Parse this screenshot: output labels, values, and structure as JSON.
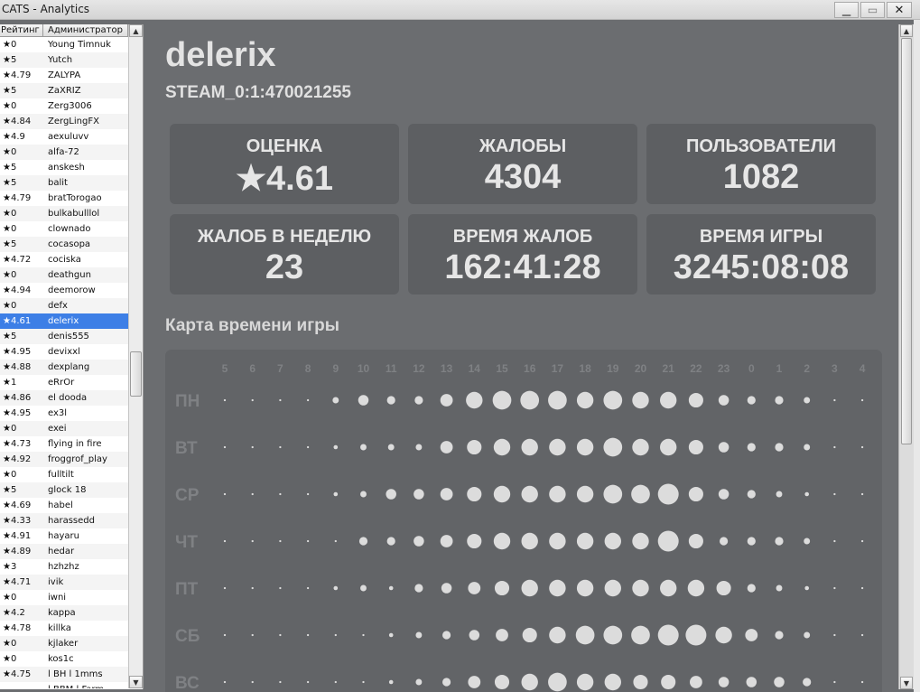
{
  "window": {
    "title": "CATS - Analytics"
  },
  "list": {
    "columns": [
      "Рейтинг",
      "Администратор"
    ],
    "rows": [
      {
        "rating": "★0",
        "name": "Young Timnuk"
      },
      {
        "rating": "★5",
        "name": "Yutch"
      },
      {
        "rating": "★4.79",
        "name": "ZALYPA"
      },
      {
        "rating": "★5",
        "name": "ZaXRIZ"
      },
      {
        "rating": "★0",
        "name": "Zerg3006"
      },
      {
        "rating": "★4.84",
        "name": "ZergLingFX"
      },
      {
        "rating": "★4.9",
        "name": "aexuluvv"
      },
      {
        "rating": "★0",
        "name": "alfa-72"
      },
      {
        "rating": "★5",
        "name": "anskesh"
      },
      {
        "rating": "★5",
        "name": "balit"
      },
      {
        "rating": "★4.79",
        "name": "bratTorogao"
      },
      {
        "rating": "★0",
        "name": "bulkabulllol"
      },
      {
        "rating": "★0",
        "name": "clownado"
      },
      {
        "rating": "★5",
        "name": "cocasopa"
      },
      {
        "rating": "★4.72",
        "name": "cociska"
      },
      {
        "rating": "★0",
        "name": "deathgun"
      },
      {
        "rating": "★4.94",
        "name": "deemorow"
      },
      {
        "rating": "★0",
        "name": "defx"
      },
      {
        "rating": "★4.61",
        "name": "delerix",
        "selected": true
      },
      {
        "rating": "★5",
        "name": "denis555"
      },
      {
        "rating": "★4.95",
        "name": "devixxl"
      },
      {
        "rating": "★4.88",
        "name": "dexplang"
      },
      {
        "rating": "★1",
        "name": "eRrOr"
      },
      {
        "rating": "★4.86",
        "name": "el dooda"
      },
      {
        "rating": "★4.95",
        "name": "ex3l"
      },
      {
        "rating": "★0",
        "name": "exei"
      },
      {
        "rating": "★4.73",
        "name": "flying in fire"
      },
      {
        "rating": "★4.92",
        "name": "froggrof_play"
      },
      {
        "rating": "★0",
        "name": "fulltilt"
      },
      {
        "rating": "★5",
        "name": "glock 18"
      },
      {
        "rating": "★4.69",
        "name": "habel"
      },
      {
        "rating": "★4.33",
        "name": "harassedd"
      },
      {
        "rating": "★4.91",
        "name": "hayaru"
      },
      {
        "rating": "★4.89",
        "name": "hedar"
      },
      {
        "rating": "★3",
        "name": "hzhzhz"
      },
      {
        "rating": "★4.71",
        "name": "ivik"
      },
      {
        "rating": "★0",
        "name": "iwni"
      },
      {
        "rating": "★4.2",
        "name": "kappa"
      },
      {
        "rating": "★4.78",
        "name": "killka"
      },
      {
        "rating": "★0",
        "name": "kjlaker"
      },
      {
        "rating": "★0",
        "name": "kos1c"
      },
      {
        "rating": "★4.75",
        "name": "l BH l 1mms"
      },
      {
        "rating": "",
        "name": "l BBM l Farm"
      }
    ]
  },
  "profile": {
    "name": "delerix",
    "steam_id": "STEAM_0:1:470021255"
  },
  "stats": [
    {
      "label": "ОЦЕНКА",
      "value": "★4.61"
    },
    {
      "label": "ЖАЛОБЫ",
      "value": "4304"
    },
    {
      "label": "ПОЛЬЗОВАТЕЛИ",
      "value": "1082"
    },
    {
      "label": "ЖАЛОБ В НЕДЕЛЮ",
      "value": "23"
    },
    {
      "label": "ВРЕМЯ ЖАЛОБ",
      "value": "162:41:28"
    },
    {
      "label": "ВРЕМЯ ИГРЫ",
      "value": "3245:08:08"
    }
  ],
  "heatmap": {
    "title": "Карта времени игры",
    "hours": [
      "5",
      "6",
      "7",
      "8",
      "9",
      "10",
      "11",
      "12",
      "13",
      "14",
      "15",
      "16",
      "17",
      "18",
      "19",
      "20",
      "21",
      "22",
      "23",
      "0",
      "1",
      "2",
      "3",
      "4"
    ],
    "days": [
      "ПН",
      "ВТ",
      "СР",
      "ЧТ",
      "ПТ",
      "СБ",
      "ВС"
    ],
    "intensity": [
      [
        1,
        1,
        1,
        1,
        3,
        5,
        4,
        4,
        6,
        8,
        9,
        9,
        9,
        8,
        9,
        8,
        8,
        7,
        5,
        4,
        4,
        3,
        1,
        1
      ],
      [
        1,
        1,
        1,
        1,
        2,
        3,
        3,
        3,
        6,
        7,
        8,
        8,
        8,
        8,
        9,
        8,
        8,
        7,
        5,
        4,
        4,
        3,
        1,
        1
      ],
      [
        1,
        1,
        1,
        1,
        2,
        3,
        5,
        5,
        6,
        7,
        8,
        8,
        8,
        8,
        9,
        9,
        10,
        7,
        5,
        4,
        3,
        2,
        1,
        1
      ],
      [
        1,
        1,
        1,
        1,
        1,
        4,
        4,
        5,
        6,
        7,
        8,
        8,
        8,
        8,
        8,
        8,
        10,
        7,
        4,
        4,
        4,
        3,
        1,
        1
      ],
      [
        1,
        1,
        1,
        1,
        2,
        3,
        2,
        4,
        5,
        6,
        7,
        8,
        8,
        8,
        8,
        8,
        8,
        8,
        7,
        4,
        3,
        2,
        1,
        1
      ],
      [
        1,
        1,
        1,
        1,
        1,
        1,
        2,
        3,
        4,
        5,
        6,
        7,
        8,
        9,
        9,
        9,
        10,
        10,
        8,
        6,
        4,
        3,
        1,
        1
      ],
      [
        1,
        1,
        1,
        1,
        1,
        1,
        2,
        3,
        4,
        6,
        7,
        8,
        9,
        8,
        8,
        7,
        7,
        6,
        5,
        5,
        5,
        4,
        1,
        1
      ]
    ],
    "colors": {
      "dot": "#dcdcdc",
      "hour_label": "#7f8184",
      "day_label": "#7f8184"
    }
  },
  "colors": {
    "background": "#6b6d70",
    "card": "#5d5f62",
    "selection": "#3d7fe6"
  }
}
